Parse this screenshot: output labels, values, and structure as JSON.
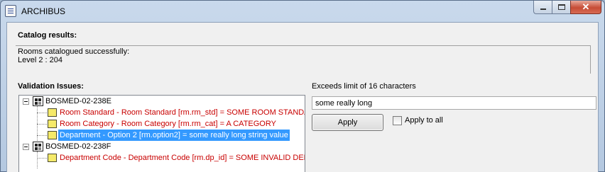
{
  "window": {
    "title": "ARCHIBUS",
    "controls": {
      "close_glyph": "✕"
    }
  },
  "catalog": {
    "label": "Catalog results:",
    "lines": [
      "Rooms catalogued successfully:",
      "Level 2 : 204"
    ]
  },
  "validation": {
    "label": "Validation Issues:",
    "groups": [
      {
        "name": "BOSMED-02-238E",
        "issues": [
          {
            "text": "Room Standard - Room Standard  [rm.rm_std] = SOME ROOM STANDARD THAT IS TOO LONG",
            "selected": false
          },
          {
            "text": "Room Category - Room Category  [rm.rm_cat] = A CATEGORY",
            "selected": false
          },
          {
            "text": "Department - Option 2  [rm.option2] = some really long string value",
            "selected": true
          }
        ]
      },
      {
        "name": "BOSMED-02-238F",
        "issues": [
          {
            "text": "Department Code - Department Code  [rm.dp_id] = SOME INVALID DEPARTMENT",
            "selected": false
          }
        ]
      }
    ]
  },
  "editor": {
    "message": "Exceeds limit of 16 characters",
    "value": "some really long",
    "apply_label": "Apply",
    "apply_all_label": "Apply to all",
    "apply_all_checked": false
  },
  "colors": {
    "error_text": "#c80000",
    "selection": "#3399ff",
    "titlebar": "#c9d9ec"
  },
  "icons": {
    "app": "archibus-app-icon",
    "group": "grid-building-icon",
    "issue": "yellow-note-icon",
    "expand": "minus-expander-icon"
  }
}
